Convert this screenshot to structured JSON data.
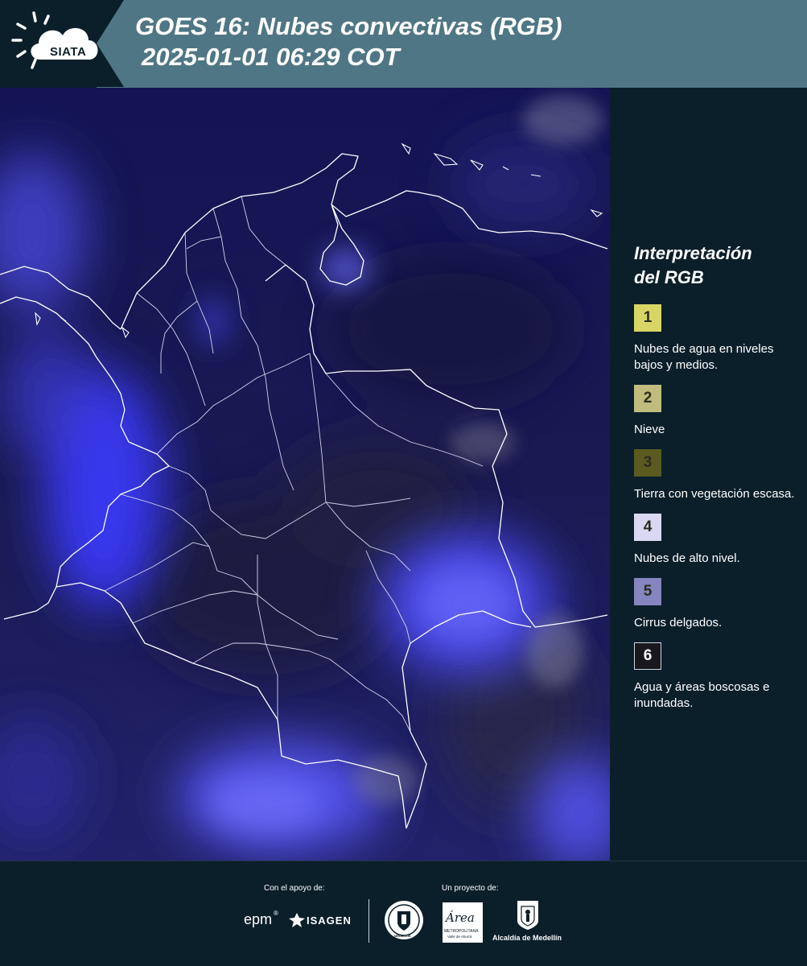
{
  "header": {
    "logo_text": "SIATA",
    "title_line1": "GOES 16: Nubes convectivas (RGB)",
    "title_line2": "2025-01-01 06:29 COT"
  },
  "legend": {
    "title_line1": "Interpretación",
    "title_line2": "del RGB",
    "items": [
      {
        "number": "1",
        "color": "#d9d564",
        "label": "Nubes de agua en niveles bajos y medios."
      },
      {
        "number": "2",
        "color": "#bfbc7c",
        "label": "Nieve"
      },
      {
        "number": "3",
        "color": "#5b5a20",
        "label": "Tierra con vegetación escasa."
      },
      {
        "number": "4",
        "color": "#d9d8f2",
        "label": "Nubes de alto nivel."
      },
      {
        "number": "5",
        "color": "#8585c0",
        "label": "Cirrus delgados."
      },
      {
        "number": "6",
        "color": "#18181e",
        "label": "Agua y áreas boscosas e inundadas."
      }
    ]
  },
  "footer": {
    "support_label": "Con el apoyo de:",
    "project_label": "Un proyecto de:",
    "sponsors": [
      "epm",
      "ISAGEN"
    ],
    "partners": [
      "MEDELLÍN",
      "Área",
      "METROPOLITANA",
      "Valle de Aburrá",
      "Alcaldía de Medellín"
    ]
  },
  "colors": {
    "header_band": "#4f7684",
    "background": "#0b1f2b",
    "map_base": "#14144a",
    "cloud_high": "#5a5aff"
  }
}
